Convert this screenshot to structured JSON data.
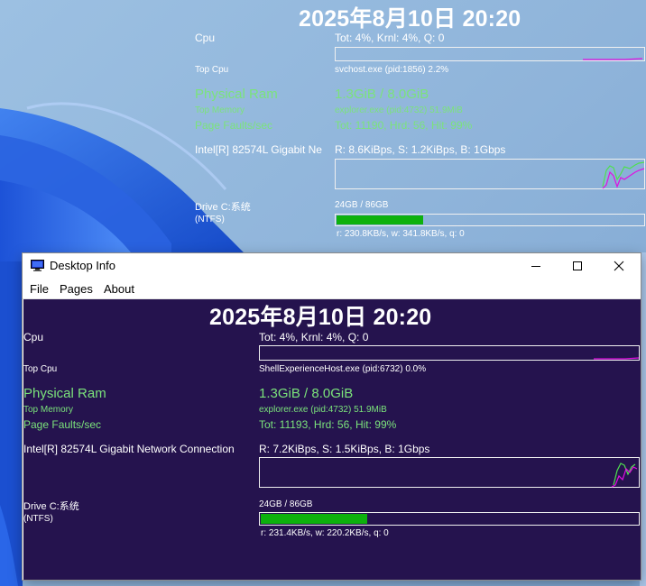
{
  "desktop_widget": {
    "datetime": "2025年8月10日  20:20",
    "cpu_label": "Cpu",
    "cpu_value": "Tot:  4%, Krnl:  4%, Q: 0",
    "top_cpu_label": "Top Cpu",
    "top_cpu_value": "svchost.exe (pid:1856) 2.2%",
    "ram_label": "Physical Ram",
    "ram_value": "1.3GiB / 8.0GiB",
    "top_memory_label": "Top Memory",
    "top_memory_value": "explorer.exe (pid:4732) 51.9MiB",
    "page_faults_label": "Page Faults/sec",
    "page_faults_value": "Tot: 11190, Hrd: 56, Hit: 99%",
    "network_label": "Intel[R] 82574L Gigabit Ne",
    "network_value": "R: 8.6KiBps, S: 1.2KiBps, B: 1Gbps",
    "drive_label": "Drive C:系统",
    "drive_fs": "(NTFS)",
    "drive_usage": "24GB / 86GB",
    "drive_usage_fraction": 0.28,
    "drive_io": "r: 230.8KB/s, w: 341.8KB/s, q: 0"
  },
  "window": {
    "title": "Desktop Info",
    "controls": {
      "minimize": "minimize",
      "maximize": "maximize",
      "close": "close"
    },
    "menu": [
      "File",
      "Pages",
      "About"
    ],
    "datetime": "2025年8月10日  20:20",
    "cpu_label": "Cpu",
    "cpu_value": "Tot:  4%, Krnl:  4%, Q: 0",
    "top_cpu_label": "Top Cpu",
    "top_cpu_value": "ShellExperienceHost.exe (pid:6732) 0.0%",
    "ram_label": "Physical Ram",
    "ram_value": "1.3GiB / 8.0GiB",
    "top_memory_label": "Top Memory",
    "top_memory_value": "explorer.exe (pid:4732) 51.9MiB",
    "page_faults_label": "Page Faults/sec",
    "page_faults_value": "Tot: 11193, Hrd: 56, Hit: 99%",
    "network_label": "Intel[R] 82574L Gigabit Network Connection",
    "network_value": "R: 7.2KiBps, S: 1.5KiBps, B: 1Gbps",
    "drive_label": "Drive C:系统",
    "drive_fs": "(NTFS)",
    "drive_usage": "24GB / 86GB",
    "drive_usage_fraction": 0.28,
    "drive_io": "r: 231.4KB/s, w: 220.2KB/s, q: 0"
  },
  "colors": {
    "client_bg": "#25134e",
    "accent_green": "#7be37b",
    "bar_green": "#0db10d",
    "graph_magenta": "#e010e0",
    "graph_green": "#4fe04f"
  },
  "icons": [
    "desktop-info-app-icon",
    "minimize-icon",
    "maximize-icon",
    "close-icon"
  ]
}
